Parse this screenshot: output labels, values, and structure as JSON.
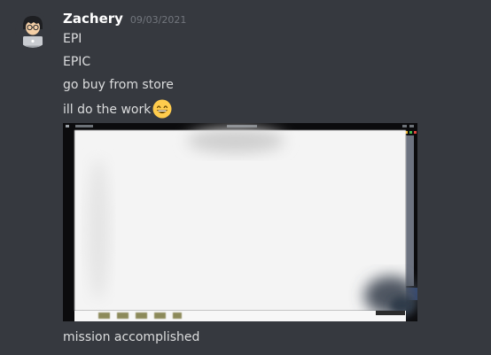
{
  "message": {
    "username": "Zachery",
    "timestamp": "09/03/2021",
    "lines": [
      "EPI",
      "EPIC",
      "go buy from store",
      "ill do the work"
    ],
    "emoji_icon": "grinning-face-emoji",
    "attachment_icon": "screenshot-image",
    "caption": "mission accomplished"
  },
  "colors": {
    "background": "#36393f",
    "username": "#ffffff",
    "timestamp": "#72767d",
    "text": "#dcddde"
  }
}
